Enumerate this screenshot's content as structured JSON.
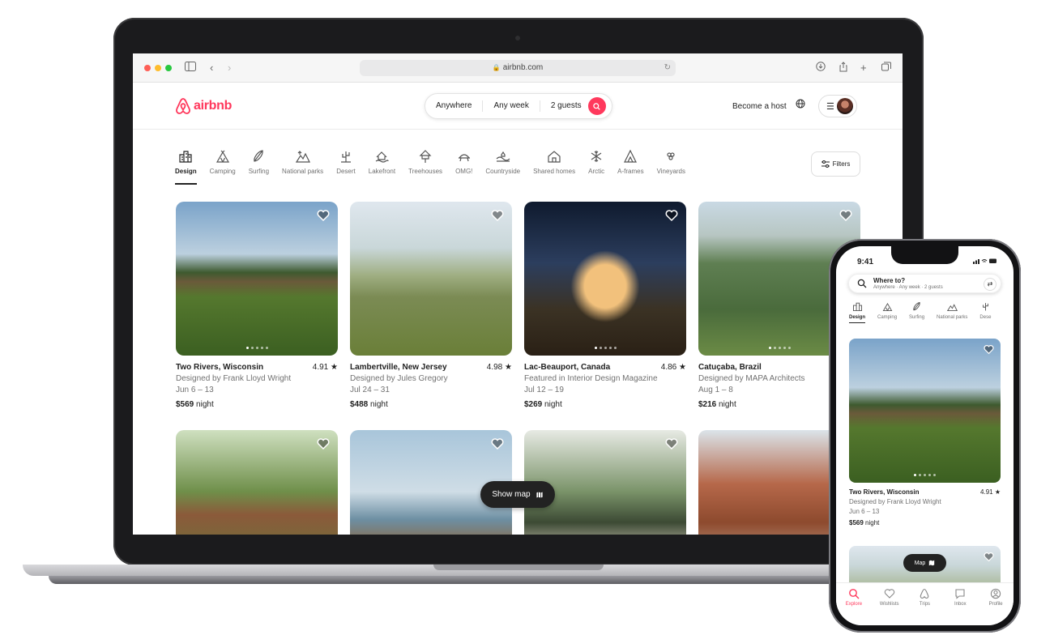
{
  "browser": {
    "url": "airbnb.com"
  },
  "brand": {
    "name": "airbnb",
    "accent_color": "#ff385c"
  },
  "header": {
    "search": {
      "where": "Anywhere",
      "when": "Any week",
      "who": "2 guests"
    },
    "become_host": "Become a host"
  },
  "categories": [
    {
      "label": "Design",
      "icon": "design-icon",
      "active": true
    },
    {
      "label": "Camping",
      "icon": "camping-icon"
    },
    {
      "label": "Surfing",
      "icon": "surfing-icon"
    },
    {
      "label": "National parks",
      "icon": "national-parks-icon"
    },
    {
      "label": "Desert",
      "icon": "desert-icon"
    },
    {
      "label": "Lakefront",
      "icon": "lakefront-icon"
    },
    {
      "label": "Treehouses",
      "icon": "treehouses-icon"
    },
    {
      "label": "OMG!",
      "icon": "omg-icon"
    },
    {
      "label": "Countryside",
      "icon": "countryside-icon"
    },
    {
      "label": "Shared homes",
      "icon": "shared-homes-icon"
    },
    {
      "label": "Arctic",
      "icon": "arctic-icon"
    },
    {
      "label": "A-frames",
      "icon": "a-frames-icon"
    },
    {
      "label": "Vineyards",
      "icon": "vineyards-icon"
    }
  ],
  "filters_label": "Filters",
  "listings": [
    {
      "location": "Two Rivers, Wisconsin",
      "rating": "4.91",
      "subtitle": "Designed by Frank Lloyd Wright",
      "dates": "Jun 6 – 13",
      "price": "$569",
      "price_unit": "night"
    },
    {
      "location": "Lambertville, New Jersey",
      "rating": "4.98",
      "subtitle": "Designed by Jules Gregory",
      "dates": "Jul 24 – 31",
      "price": "$488",
      "price_unit": "night"
    },
    {
      "location": "Lac-Beauport, Canada",
      "rating": "4.86",
      "subtitle": "Featured in Interior Design Magazine",
      "dates": "Jul 12 – 19",
      "price": "$269",
      "price_unit": "night"
    },
    {
      "location": "Catuçaba, Brazil",
      "rating": "",
      "subtitle": "Designed by MAPA Architects",
      "dates": "Aug 1 – 8",
      "price": "$216",
      "price_unit": "night"
    }
  ],
  "show_map_label": "Show map",
  "phone": {
    "time": "9:41",
    "search_title": "Where to?",
    "search_subtitle": "Anywhere · Any week · 2 guests",
    "categories": [
      "Design",
      "Camping",
      "Surfing",
      "National parks",
      "Dese"
    ],
    "listing": {
      "location": "Two Rivers, Wisconsin",
      "rating": "4.91",
      "subtitle": "Designed by Frank Lloyd Wright",
      "dates": "Jun 6 – 13",
      "price": "$569",
      "price_unit": "night"
    },
    "map_label": "Map",
    "tabs": [
      {
        "label": "Explore",
        "icon": "explore-icon",
        "active": true
      },
      {
        "label": "Wishlists",
        "icon": "wishlists-icon"
      },
      {
        "label": "Trips",
        "icon": "trips-icon"
      },
      {
        "label": "Inbox",
        "icon": "inbox-icon"
      },
      {
        "label": "Profile",
        "icon": "profile-icon"
      }
    ]
  }
}
